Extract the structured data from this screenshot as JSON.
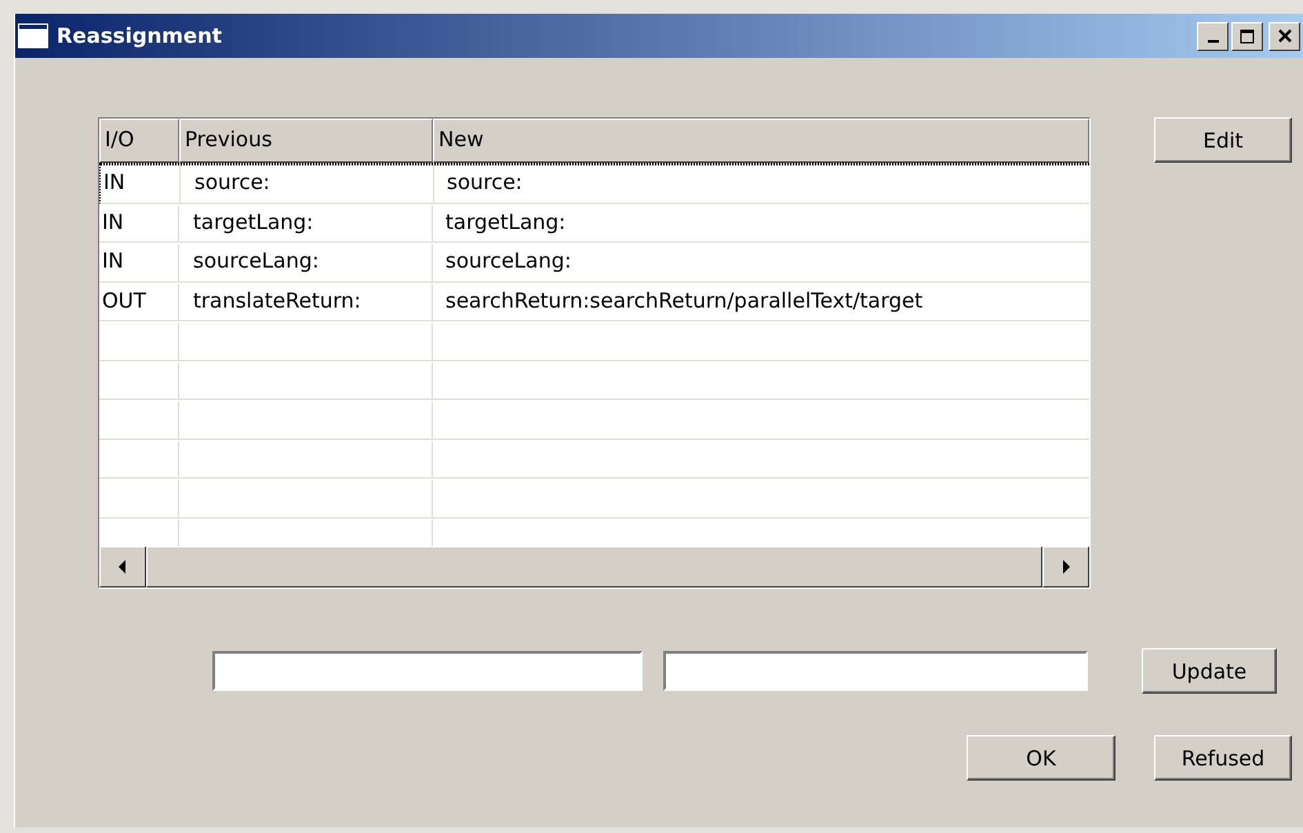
{
  "window": {
    "title": "Reassignment"
  },
  "table": {
    "columns": [
      "I/O",
      "Previous",
      "New"
    ],
    "rows": [
      {
        "io": "IN",
        "previous": "source:",
        "new": "source:",
        "focused": true
      },
      {
        "io": "IN",
        "previous": "targetLang:",
        "new": "targetLang:",
        "focused": false
      },
      {
        "io": "IN",
        "previous": "sourceLang:",
        "new": "sourceLang:",
        "focused": false
      },
      {
        "io": "OUT",
        "previous": "translateReturn:",
        "new": "searchReturn:searchReturn/parallelText/target",
        "focused": false
      }
    ]
  },
  "buttons": {
    "edit": "Edit",
    "update": "Update",
    "ok": "OK",
    "refused": "Refused"
  }
}
